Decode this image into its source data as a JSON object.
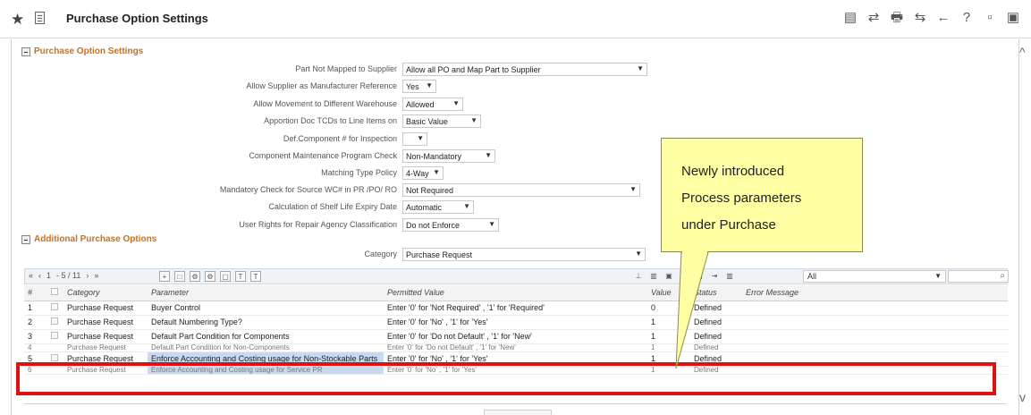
{
  "header": {
    "title": "Purchase Option Settings",
    "tools": [
      "▤",
      "⇄",
      "🖶",
      "⇆",
      "←",
      "?",
      "▫",
      "▣"
    ]
  },
  "sections": {
    "main": "Purchase Option Settings",
    "additional": "Additional Purchase Options"
  },
  "settings": [
    {
      "label": "Part Not Mapped to Supplier",
      "value": "Allow all PO and Map Part to Supplier"
    },
    {
      "label": "Allow Supplier as Manufacturer Reference",
      "value": "Yes"
    },
    {
      "label": "Allow Movement to Different Warehouse",
      "value": "Allowed"
    },
    {
      "label": "Apportion Doc TCDs to Line Items on",
      "value": "Basic Value"
    },
    {
      "label": "Def.Component # for Inspection",
      "value": ""
    },
    {
      "label": "Component Maintenance Program Check",
      "value": "Non-Mandatory"
    },
    {
      "label": "Matching Type Policy",
      "value": "4-Way"
    },
    {
      "label": "Mandatory Check for Source WC# in PR /PO/ RO",
      "value": "Not Required"
    },
    {
      "label": "Calculation of Shelf Life Expiry Date",
      "value": "Automatic"
    },
    {
      "label": "User Rights for Repair Agency Classification",
      "value": "Do not Enforce"
    }
  ],
  "category": {
    "label": "Category",
    "value": "Purchase Request"
  },
  "grid": {
    "pager": {
      "current": "1",
      "total": "- 5 / 11"
    },
    "filter_value": "All",
    "columns": [
      "#",
      "",
      "Category",
      "Parameter",
      "Permitted Value",
      "Value",
      "Status",
      "Error Message"
    ],
    "rows": [
      {
        "num": "1",
        "category": "Purchase Request",
        "parameter": "Buyer Control",
        "permitted": "Enter '0' for 'Not Required' , '1' for 'Required'",
        "value": "0",
        "status": "Defined",
        "error": ""
      },
      {
        "num": "2",
        "category": "Purchase Request",
        "parameter": "Default Numbering Type?",
        "permitted": "Enter '0' for 'No' , '1' for 'Yes'",
        "value": "1",
        "status": "Defined",
        "error": ""
      },
      {
        "num": "3",
        "category": "Purchase Request",
        "parameter": "Default Part Condition for Components",
        "permitted": "Enter '0' for 'Do not Default' , '1' for 'New'",
        "value": "1",
        "status": "Defined",
        "error": ""
      },
      {
        "num": "4",
        "category": "Purchase Request",
        "parameter": "Default Part Condition for Non-Components",
        "permitted": "Enter '0' for 'Do not Default' , '1' for 'New'",
        "value": "1",
        "status": "Defined",
        "error": ""
      },
      {
        "num": "5",
        "category": "Purchase Request",
        "parameter": "Enforce Accounting and Costing usage for Non-Stockable Parts",
        "permitted": "Enter '0' for 'No' , '1' for 'Yes'",
        "value": "1",
        "status": "Defined",
        "error": ""
      },
      {
        "num": "6",
        "category": "Purchase Request",
        "parameter": "Enforce Accounting and Costing usage for Service PR",
        "permitted": "Enter '0' for 'No' , '1' for 'Yes'",
        "value": "1",
        "status": "Defined",
        "error": ""
      }
    ]
  },
  "callout": {
    "line1": "Newly introduced",
    "line2": "Process parameters",
    "line3": "under Purchase"
  },
  "colors": {
    "highlight_border": "#e11010",
    "callout_bg": "#ffffa3",
    "section_head": "#c8701c",
    "selected_cell": "#c7d9ee"
  }
}
